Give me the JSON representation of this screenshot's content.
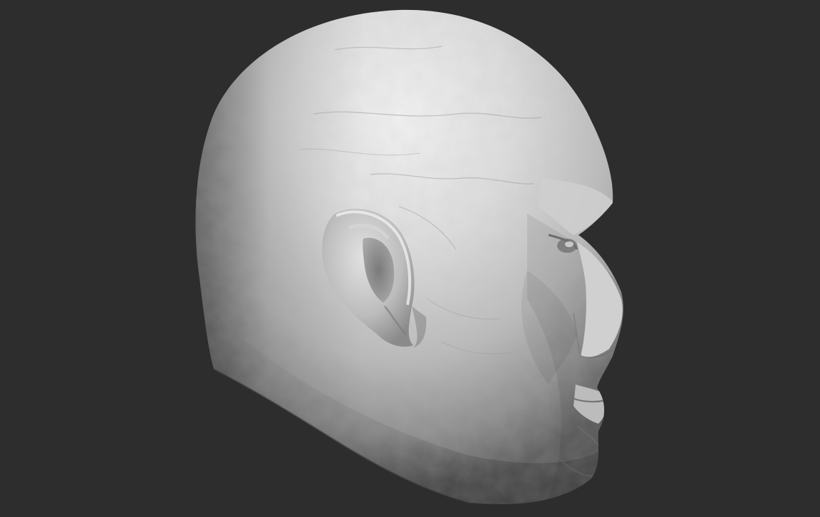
{
  "scene": {
    "subject": "head-sculpt",
    "background_color": "#2d2d2d",
    "material_highlight_color": "#f0f0f0",
    "material_midtone_color": "#b8b8b8",
    "material_shadow_color": "#6a6a6a"
  }
}
